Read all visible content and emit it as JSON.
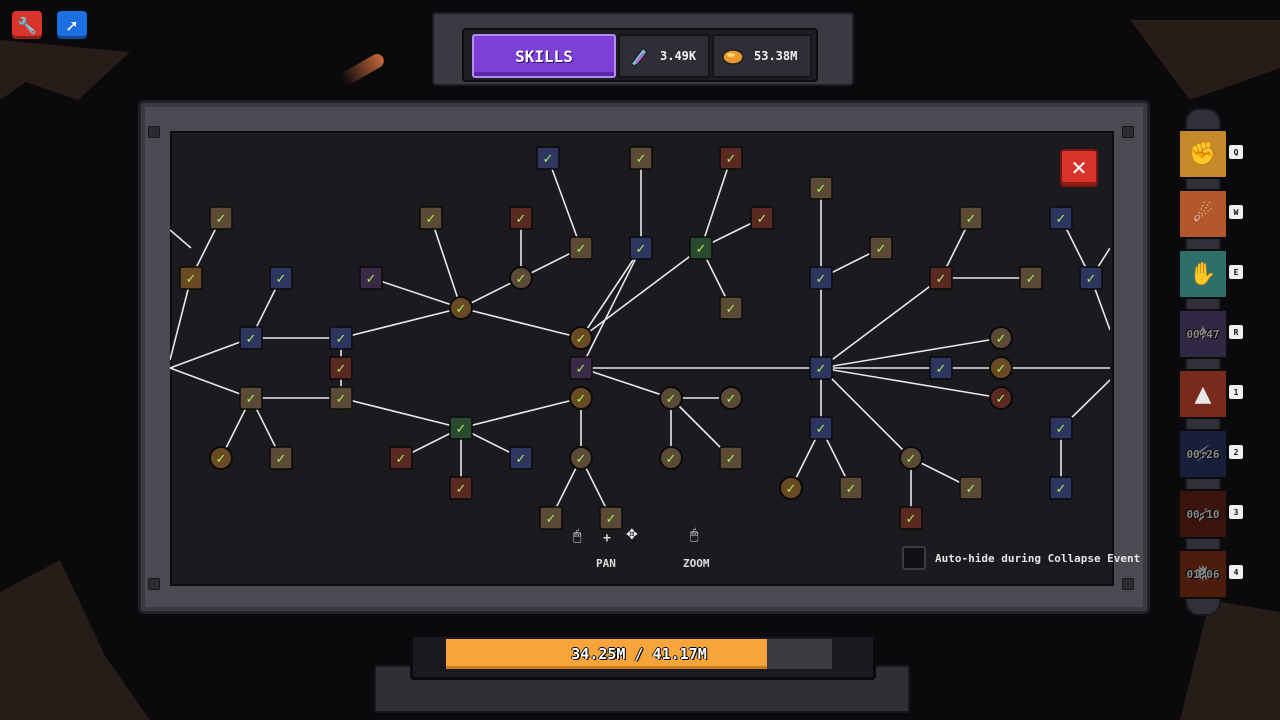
{
  "header": {
    "tab_label": "SKILLS",
    "crystals": "3.49K",
    "gold": "53.38M"
  },
  "panel": {
    "close_label": "✕",
    "controls": {
      "pan_label": "PAN",
      "zoom_label": "ZOOM",
      "plus": "+"
    },
    "auto_hide_label": "Auto-hide during Collapse Event"
  },
  "progress": {
    "label": "34.25M / 41.17M",
    "fraction": 0.832
  },
  "abilities": [
    {
      "key": "Q",
      "timer": "",
      "icon": "gauntlet-icon",
      "color": "#c68a2a"
    },
    {
      "key": "W",
      "timer": "",
      "icon": "meteor-icon",
      "color": "#b2582a"
    },
    {
      "key": "E",
      "timer": "",
      "icon": "grab-hand-icon",
      "color": "#2f6f6a"
    },
    {
      "key": "R",
      "timer": "00:47",
      "icon": "spirit-icon",
      "color": "#5a4a7a"
    },
    {
      "key": "1",
      "timer": "",
      "icon": "volcano-icon",
      "color": "#7a2a1c"
    },
    {
      "key": "2",
      "timer": "00:26",
      "icon": "lightning-icon",
      "color": "#2a3a6a"
    },
    {
      "key": "3",
      "timer": "00:10",
      "icon": "fire-arrow-icon",
      "color": "#6a2416"
    },
    {
      "key": "4",
      "timer": "01:06",
      "icon": "explosion-icon",
      "color": "#8a3418"
    }
  ],
  "colors": {
    "accent_purple": "#7c3fd8",
    "bar_orange": "#f7a43a",
    "close_red": "#d9342b",
    "check_green": "#a8f05a"
  }
}
